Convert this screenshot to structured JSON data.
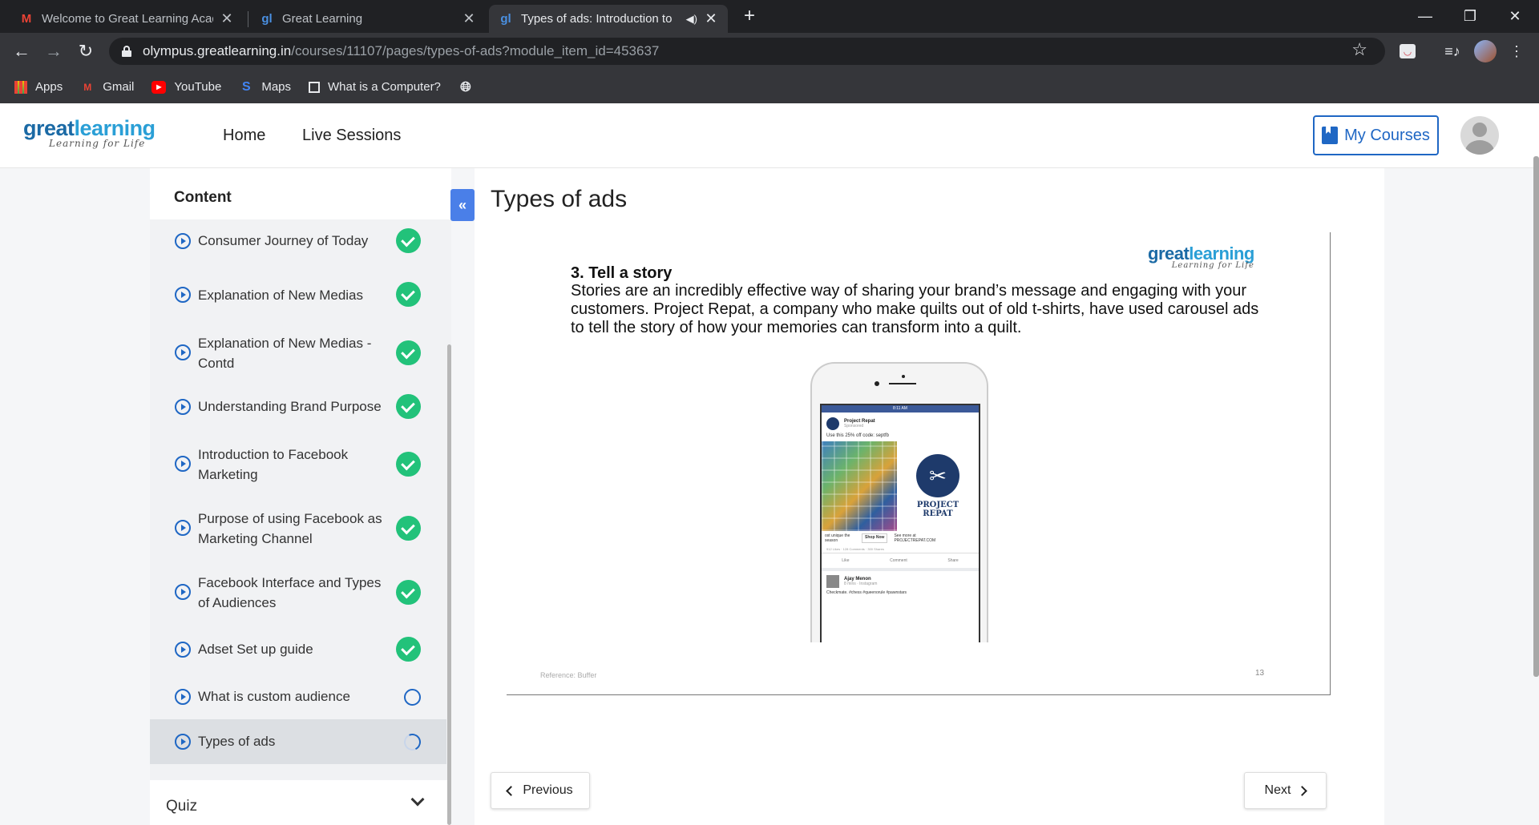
{
  "browser": {
    "tabs": [
      {
        "title": "Welcome to Great Learning Acad",
        "icon": "gmail-icon"
      },
      {
        "title": "Great Learning",
        "icon": "greatlearning-icon"
      },
      {
        "title": "Types of ads: Introduction to",
        "icon": "greatlearning-icon",
        "active": true
      }
    ],
    "url_host": "olympus.greatlearning.in",
    "url_path": "/courses/11107/pages/types-of-ads?module_item_id=453637",
    "bookmarks": [
      {
        "label": "Apps",
        "icon": "apps-grid-icon"
      },
      {
        "label": "Gmail",
        "icon": "gmail-icon"
      },
      {
        "label": "YouTube",
        "icon": "youtube-icon"
      },
      {
        "label": "Maps",
        "icon": "maps-icon"
      },
      {
        "label": "What is a Computer?",
        "icon": "page-icon"
      }
    ]
  },
  "header": {
    "logo_main_1": "great",
    "logo_main_2": "learning",
    "logo_sub": "Learning for Life",
    "nav": [
      "Home",
      "Live Sessions"
    ],
    "my_courses": "My Courses"
  },
  "sidebar": {
    "title": "Content",
    "items": [
      {
        "label": "Consumer Journey of Today",
        "status": "done"
      },
      {
        "label": "Explanation of New Medias",
        "status": "done"
      },
      {
        "label": "Explanation of New Medias - Contd",
        "status": "done"
      },
      {
        "label": "Understanding Brand Purpose",
        "status": "done"
      },
      {
        "label": "Introduction to Facebook Marketing",
        "status": "done"
      },
      {
        "label": "Purpose of using Facebook as Marketing Channel",
        "status": "done"
      },
      {
        "label": "Facebook Interface and Types of Audiences",
        "status": "done"
      },
      {
        "label": "Adset Set up guide",
        "status": "done"
      },
      {
        "label": "What is custom audience",
        "status": "not-started"
      },
      {
        "label": "Types of ads",
        "status": "in-progress",
        "current": true
      }
    ],
    "quiz_label": "Quiz"
  },
  "main": {
    "title": "Types of ads",
    "slide": {
      "heading": "3. Tell a story",
      "body": "Stories are an incredibly effective way of sharing your brand’s message and engaging with your customers. Project Repat, a company who make quilts out of old t-shirts, have used carousel ads to tell the story of how your memories can transform into a quilt.",
      "reference": "Reference: Buffer",
      "page_number": "13",
      "phone": {
        "status_time": "8:11 AM",
        "post_name": "Project Repat",
        "post_sub": "Sponsored",
        "post_text": "Use this 25% off code: septfb",
        "brand_line1": "PROJECT",
        "brand_line2": "REPAT",
        "cta_left": "ost unique the season",
        "cta_button": "Shop Now",
        "cta_right": "See more at PROJECTREPAT.COM",
        "stats": "912 Likes · 128 Comments · 300 Shares",
        "actions": [
          "Like",
          "Comment",
          "Share"
        ],
        "post2_name": "Ajay Menon",
        "post2_sub": "8 mins · Instagram",
        "post2_text": "Checkmate. #chess #queenorule #pawnstars"
      }
    },
    "prev_label": "Previous",
    "next_label": "Next"
  }
}
